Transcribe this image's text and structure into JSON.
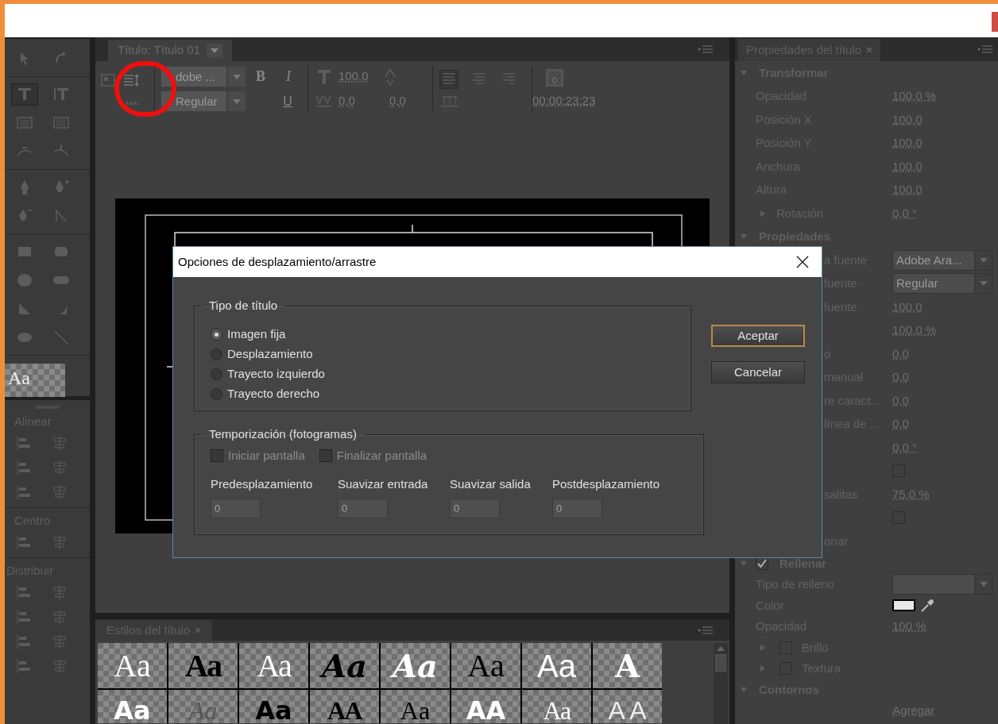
{
  "title_panel": {
    "tab": "Título: Título 01",
    "font_family": "dobe ...",
    "font_style": "Regular",
    "bold": "B",
    "italic": "I",
    "underline": "U",
    "font_size": "100,0",
    "kerning": "0,0",
    "leading": "0,0",
    "timecode": "00:00:23:23"
  },
  "tools": [
    {
      "kind": "selection",
      "selected": false
    },
    {
      "kind": "rotation",
      "selected": false
    },
    {
      "kind": "type",
      "selected": true
    },
    {
      "kind": "vertical-type",
      "selected": false
    },
    {
      "kind": "area-type",
      "selected": false
    },
    {
      "kind": "vertical-area-type",
      "selected": false
    },
    {
      "kind": "path-type",
      "selected": false
    },
    {
      "kind": "vertical-path-type",
      "selected": false
    },
    {
      "kind": "pen",
      "selected": false
    },
    {
      "kind": "add-anchor",
      "selected": false
    },
    {
      "kind": "delete-anchor",
      "selected": false
    },
    {
      "kind": "convert-anchor",
      "selected": false
    },
    {
      "kind": "rectangle",
      "selected": false
    },
    {
      "kind": "clipped-rectangle",
      "selected": false
    },
    {
      "kind": "rounded-rectangle",
      "selected": false
    },
    {
      "kind": "pill",
      "selected": false
    },
    {
      "kind": "wedge",
      "selected": false
    },
    {
      "kind": "arc",
      "selected": false
    },
    {
      "kind": "ellipse",
      "selected": false
    },
    {
      "kind": "line",
      "selected": false
    }
  ],
  "style_preview": "Aa",
  "align_panel": {
    "sections": [
      {
        "title": "Alinear"
      },
      {
        "title": "Centro"
      },
      {
        "title": "Distribuir"
      }
    ]
  },
  "styles_panel": {
    "tab": "Estilos del título",
    "swatches": [
      {
        "sample": "Aa",
        "kind": "serif-white"
      },
      {
        "sample": "Aa",
        "kind": "condensed-black"
      },
      {
        "sample": "Aa",
        "kind": "condensed-white"
      },
      {
        "sample": "Aa",
        "kind": "script-black"
      },
      {
        "sample": "Aa",
        "kind": "script-white"
      },
      {
        "sample": "Aa",
        "kind": "serif-black"
      },
      {
        "sample": "Aa",
        "kind": "sans-white"
      },
      {
        "sample": "A",
        "kind": "slab-white"
      },
      {
        "sample": "Aa",
        "kind": "bold-white"
      },
      {
        "sample": "Aa",
        "kind": "ornate"
      },
      {
        "sample": "Aa",
        "kind": "outline-black"
      },
      {
        "sample": "AA",
        "kind": "condensed-black"
      },
      {
        "sample": "Aa",
        "kind": "serif-black"
      },
      {
        "sample": "AA",
        "kind": "bold-white"
      },
      {
        "sample": "Aa",
        "kind": "condensed-white"
      },
      {
        "sample": "A A",
        "kind": "outline-white"
      }
    ]
  },
  "properties_panel": {
    "tab": "Propiedades del título",
    "sections": [
      {
        "title": "Transformar",
        "expanded": true,
        "rows": [
          {
            "kind": "value",
            "label": "Opacidad",
            "value": "100,0 %"
          },
          {
            "kind": "value",
            "label": "Posición X",
            "value": "100,0"
          },
          {
            "kind": "value",
            "label": "Posición Y",
            "value": "100,0"
          },
          {
            "kind": "value",
            "label": "Anchura",
            "value": "100,0"
          },
          {
            "kind": "value",
            "label": "Altura",
            "value": "100,0"
          },
          {
            "kind": "group",
            "label": "Rotación",
            "value": "0,0 °",
            "expanded": false
          }
        ]
      },
      {
        "title": "Propiedades",
        "expanded": true,
        "rows": [
          {
            "kind": "dropdown",
            "label": "a fuente",
            "value": "Adobe Ara..."
          },
          {
            "kind": "dropdown",
            "label": "fuente",
            "value": "Regular"
          },
          {
            "kind": "value",
            "label": "fuente",
            "value": "100,0"
          },
          {
            "kind": "value",
            "value": "100,0 %"
          },
          {
            "kind": "value",
            "label": "o",
            "value": "0,0"
          },
          {
            "kind": "value",
            "label": "manual",
            "value": "0,0"
          },
          {
            "kind": "value",
            "label": "re caract...",
            "value": "0,0"
          },
          {
            "kind": "value",
            "label": "línea de ...",
            "value": "0,0"
          },
          {
            "kind": "value",
            "value": "0,0 °"
          },
          {
            "kind": "checkbox",
            "checked": false
          },
          {
            "kind": "value",
            "label": "salitas",
            "value": "75,0 %"
          },
          {
            "kind": "checkbox",
            "checked": false
          },
          {
            "kind": "text",
            "label": "onar"
          }
        ]
      },
      {
        "title": "Rellenar",
        "expanded": true,
        "checked": true,
        "rows": [
          {
            "kind": "dropdown",
            "label": "Tipo de relleno"
          },
          {
            "kind": "color",
            "label": "Color",
            "color": "#e8e8e8"
          },
          {
            "kind": "value",
            "label": "Opacidad",
            "value": "100 %"
          },
          {
            "kind": "group",
            "label": "Brillo",
            "expanded": false,
            "checked": false
          },
          {
            "kind": "group",
            "label": "Textura",
            "expanded": false,
            "checked": false
          }
        ]
      },
      {
        "title": "Contornos",
        "expanded": true,
        "rows": [
          {
            "kind": "value",
            "value": "Agregar"
          }
        ]
      }
    ]
  },
  "dialog": {
    "title": "Opciones de desplazamiento/arrastre",
    "groups": [
      {
        "kind": "radio",
        "title": "Tipo de título",
        "options": [
          {
            "label": "Imagen fija",
            "selected": true
          },
          {
            "label": "Desplazamiento",
            "selected": false
          },
          {
            "label": "Trayecto izquierdo",
            "selected": false
          },
          {
            "label": "Trayecto derecho",
            "selected": false
          }
        ]
      },
      {
        "kind": "timing",
        "title": "Temporización (fotogramas)",
        "checkboxes": [
          {
            "label": "Iniciar pantalla",
            "checked": false,
            "disabled": true
          },
          {
            "label": "Finalizar pantalla",
            "checked": false,
            "disabled": true
          }
        ],
        "fields": [
          {
            "label": "Predesplazamiento",
            "value": "0",
            "disabled": true
          },
          {
            "label": "Suavizar entrada",
            "value": "0",
            "disabled": true
          },
          {
            "label": "Suavizar salida",
            "value": "0",
            "disabled": true
          },
          {
            "label": "Postdesplazamiento",
            "value": "0",
            "disabled": true
          }
        ]
      }
    ],
    "buttons": [
      {
        "label": "Aceptar",
        "default": true
      },
      {
        "label": "Cancelar",
        "default": false
      }
    ]
  }
}
